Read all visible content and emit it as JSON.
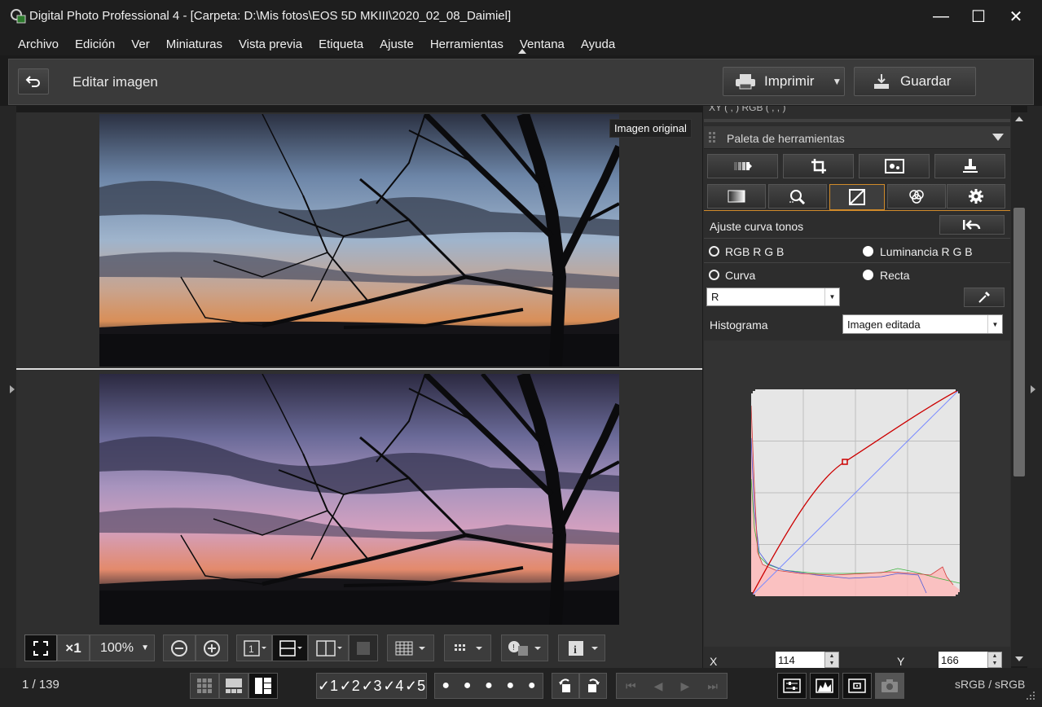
{
  "window": {
    "title": "Digital Photo Professional 4 - [Carpeta: D:\\Mis fotos\\EOS 5D MKIII\\2020_02_08_Daimiel]",
    "minimize": "—",
    "maximize": "☐",
    "close": "✕"
  },
  "menu": [
    "Archivo",
    "Edición",
    "Ver",
    "Miniaturas",
    "Vista previa",
    "Etiqueta",
    "Ajuste",
    "Herramientas",
    "Ventana",
    "Ayuda"
  ],
  "toolbar": {
    "back_icon": "back-arrow-icon",
    "heading": "Editar imagen",
    "print_label": "Imprimir",
    "save_label": "Guardar"
  },
  "viewer": {
    "tooltip": "Imagen original"
  },
  "image_toolbar": {
    "zoom_x1": "×1",
    "zoom_value": "100%"
  },
  "status": {
    "page_count": "1 / 139",
    "colorspace": "sRGB / sRGB",
    "check_labels": [
      "1",
      "2",
      "3",
      "4",
      "5"
    ]
  },
  "panel": {
    "partial_top_text": "XY (    ,    ) RGB (    ,    ,    )",
    "palette_title": "Paleta de herramientas",
    "section_title": "Ajuste curva tonos",
    "radio_rgb": "RGB R G B",
    "radio_luminance": "Luminancia R G B",
    "radio_curve": "Curva",
    "radio_straight": "Recta",
    "channel_value": "R",
    "histogram_label": "Histograma",
    "histogram_value": "Imagen editada",
    "x_label": "X",
    "x_value": "114",
    "y_label": "Y",
    "y_value": "166",
    "active_tab": "tone-curve-tab"
  },
  "colors": {
    "accent": "#d08a2a",
    "curve_red": "#cc0000",
    "diagonal_blue": "#7b8cff",
    "graph_bg": "#e6e6e6"
  }
}
